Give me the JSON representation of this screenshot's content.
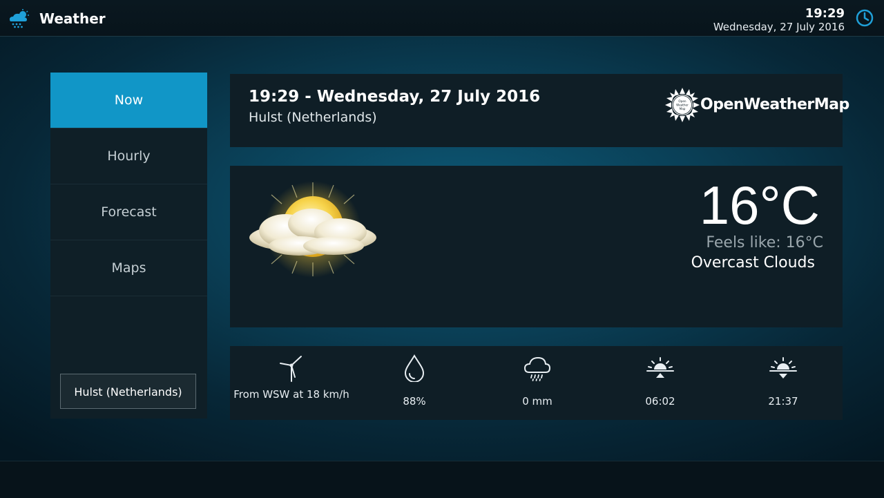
{
  "topbar": {
    "title": "Weather",
    "time": "19:29",
    "date": "Wednesday, 27 July 2016"
  },
  "sidebar": {
    "items": [
      {
        "label": "Now",
        "active": true
      },
      {
        "label": "Hourly",
        "active": false
      },
      {
        "label": "Forecast",
        "active": false
      },
      {
        "label": "Maps",
        "active": false
      }
    ],
    "location_button": "Hulst (Netherlands)"
  },
  "header": {
    "title": "19:29 - Wednesday, 27 July 2016",
    "location": "Hulst (Netherlands)",
    "provider": "OpenWeatherMap",
    "provider_logo_text": [
      "Open",
      "Weather",
      "Map"
    ]
  },
  "current": {
    "temperature": "16°C",
    "feels_like": "Feels like: 16°C",
    "condition": "Overcast Clouds",
    "icon": "partly-cloudy-sun"
  },
  "details": {
    "wind": {
      "icon": "wind-turbine-icon",
      "value": "From WSW at 18 km/h"
    },
    "humidity": {
      "icon": "droplet-icon",
      "value": "88%"
    },
    "precipitation": {
      "icon": "rain-cloud-icon",
      "value": "0 mm"
    },
    "sunrise": {
      "icon": "sunrise-icon",
      "value": "06:02"
    },
    "sunset": {
      "icon": "sunset-icon",
      "value": "21:37"
    }
  },
  "colors": {
    "accent": "#1196c7",
    "panel": "#0f1e26"
  }
}
